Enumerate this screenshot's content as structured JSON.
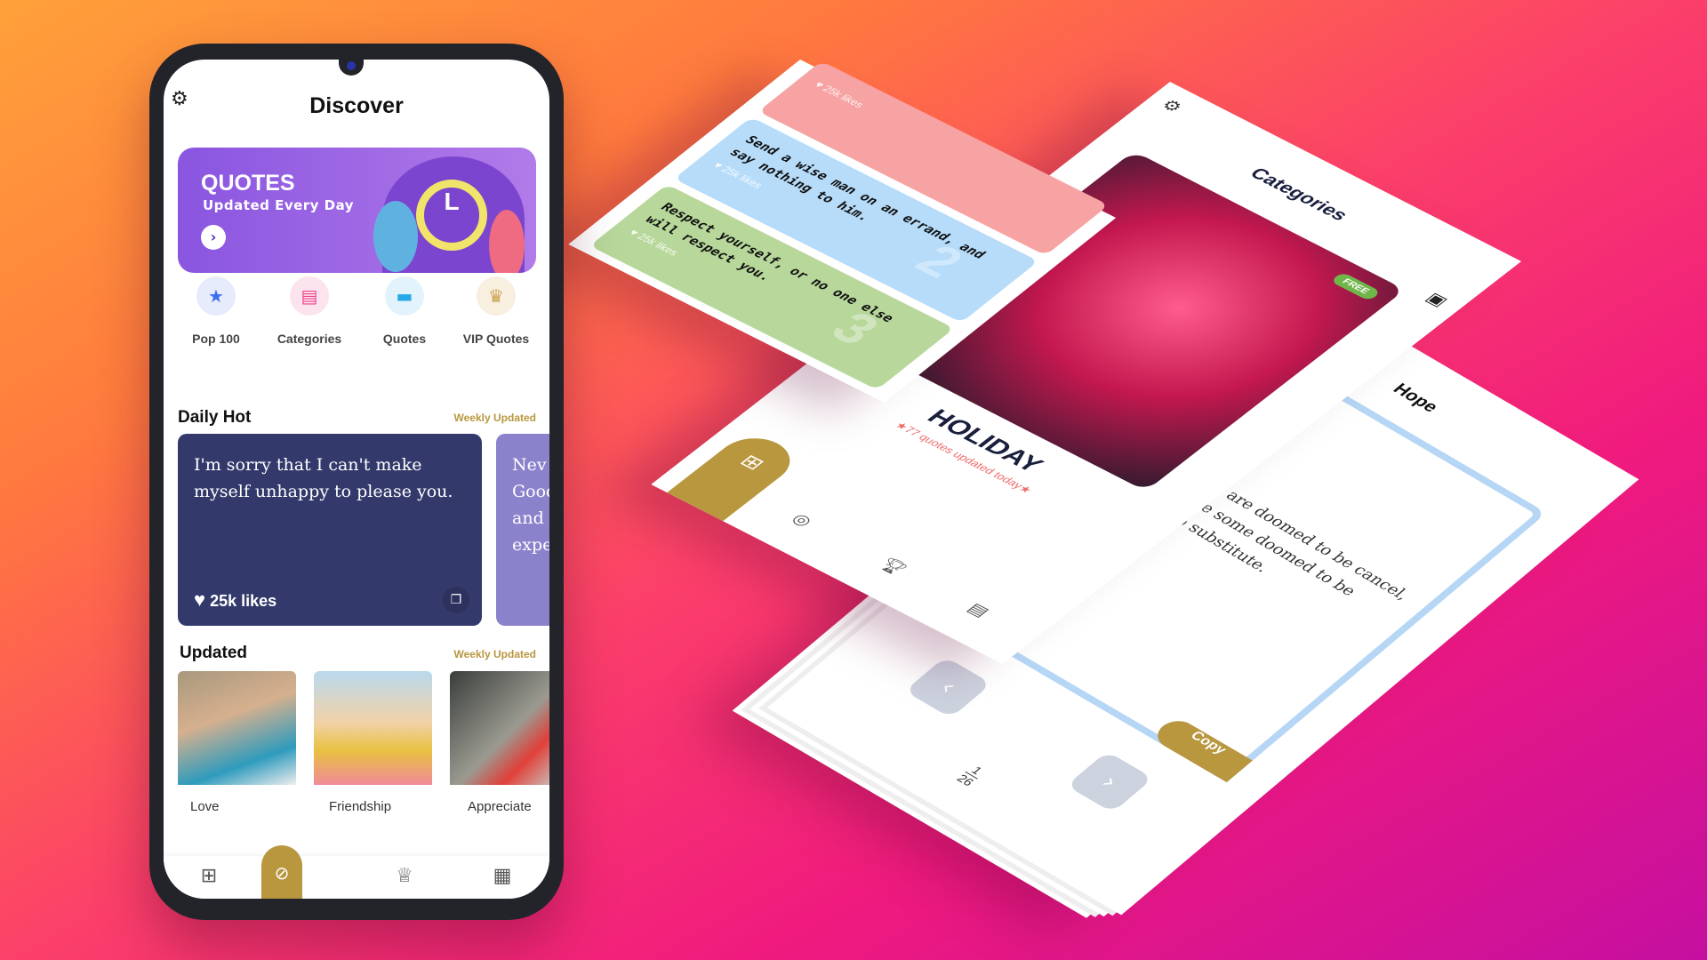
{
  "phone": {
    "title": "Discover",
    "banner": {
      "title": "QUOTES",
      "subtitle": "Updated Every Day"
    },
    "shortcuts": [
      {
        "label": "Pop 100",
        "icon": "star-icon",
        "color": "#3f6ef0"
      },
      {
        "label": "Categories",
        "icon": "bookmark-icon",
        "color": "#f0418a"
      },
      {
        "label": "Quotes",
        "icon": "card-icon",
        "color": "#28a8e8"
      },
      {
        "label": "VIP Quotes",
        "icon": "crown-icon",
        "color": "#c9a34e"
      }
    ],
    "daily_hot": {
      "title": "Daily Hot",
      "link": "Weekly Updated",
      "cards": [
        {
          "text": "I'm sorry that I can't make myself unhappy to please you.",
          "likes": "25k likes",
          "color": "#333a6b"
        },
        {
          "text": "Nev Good and expe",
          "color": "#8a83cc"
        }
      ]
    },
    "updated": {
      "title": "Updated",
      "link": "Weekly Updated",
      "items": [
        "Love",
        "Friendship",
        "Appreciate"
      ]
    },
    "nav": [
      "grid-icon",
      "compass-icon",
      "trophy-icon",
      "store-icon"
    ],
    "accent": "#b8973f"
  },
  "quote_list": {
    "cards": [
      {
        "likes": "25k likes",
        "color": "#f7a3a3"
      },
      {
        "text": "Send a wise man on an errand, and say nothing to him.",
        "likes": "25k likes",
        "number": "2",
        "color": "#b6dcfa"
      },
      {
        "text": "Respect yourself, or no one else will respect you.",
        "likes": "25k likes",
        "number": "3",
        "color": "#b7d89a"
      }
    ]
  },
  "categories": {
    "title": "Categories",
    "badge": "FREE",
    "category": "HOLIDAY",
    "subtitle": "77 quotes updated today"
  },
  "reader": {
    "title": "Hope",
    "text": "...mories, are doomed to be cancel, is just like some doomed to be unable to substitute.",
    "copy": "Copy",
    "page": "1",
    "total": "26"
  }
}
